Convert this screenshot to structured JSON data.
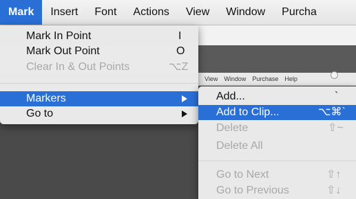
{
  "menubar": {
    "items": [
      {
        "label": "Mark",
        "selected": true
      },
      {
        "label": "Insert"
      },
      {
        "label": "Font"
      },
      {
        "label": "Actions"
      },
      {
        "label": "View"
      },
      {
        "label": "Window"
      },
      {
        "label": "Purcha"
      }
    ]
  },
  "background_window": {
    "mini_menu": [
      "View",
      "Window",
      "Purchase",
      "Help"
    ]
  },
  "mark_menu": {
    "items": [
      {
        "label": "Mark In Point",
        "shortcut": "I",
        "enabled": true
      },
      {
        "label": "Mark Out Point",
        "shortcut": "O",
        "enabled": true
      },
      {
        "label": "Clear In & Out Points",
        "shortcut": "⌥Z",
        "enabled": false
      },
      {
        "label": "Markers",
        "submenu": true,
        "highlighted": true
      },
      {
        "label": "Go to",
        "submenu": true
      }
    ]
  },
  "markers_menu": {
    "items": [
      {
        "label": "Add...",
        "shortcut": "`",
        "enabled": true
      },
      {
        "label": "Add to Clip...",
        "shortcut": "⌥⌘`",
        "enabled": true,
        "highlighted": true
      },
      {
        "label": "Delete",
        "shortcut": "⇧~",
        "enabled": false
      },
      {
        "label": "Delete All",
        "enabled": false
      },
      {
        "label": "Go to Next",
        "shortcut": "⇧↑",
        "enabled": false
      },
      {
        "label": "Go to Previous",
        "shortcut": "⇧↓",
        "enabled": false
      }
    ]
  },
  "colors": {
    "accent": "#2a6fd6",
    "menu_bg": "#eeeeee",
    "disabled_text": "#a8a8a8",
    "desktop": "#4a4a4a"
  }
}
